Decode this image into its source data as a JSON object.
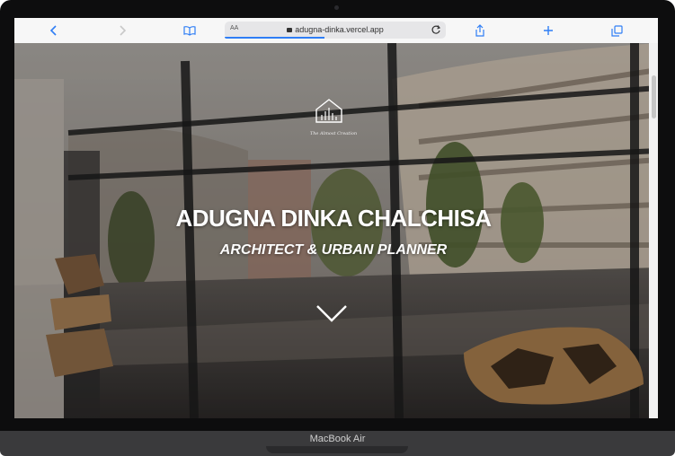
{
  "browser": {
    "address_prefix": "AA",
    "url": "adugna-dinka.vercel.app",
    "load_progress": 0.45
  },
  "toolbar": {
    "icons": [
      "back-icon",
      "forward-icon",
      "reader-icon",
      "reload-icon",
      "share-icon",
      "new-tab-icon",
      "tabs-icon"
    ]
  },
  "hero": {
    "logo_caption": "The Almost Creation",
    "title": "ADUGNA DINKA CHALCHISA",
    "subtitle": "ARCHITECT & URBAN PLANNER"
  },
  "device": {
    "label": "MacBook Air"
  },
  "colors": {
    "accent": "#2f7ef5",
    "bezel": "#0d0d0e",
    "hero_text": "#ffffff"
  }
}
